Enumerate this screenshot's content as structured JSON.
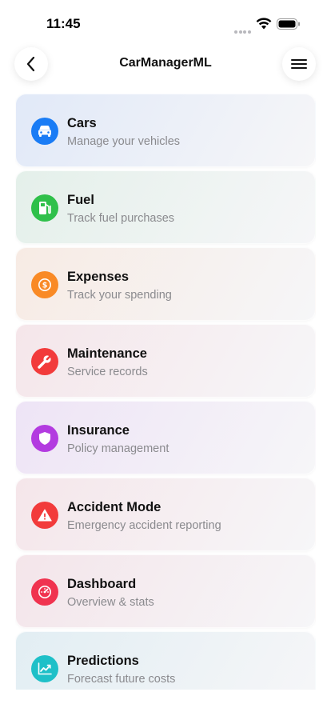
{
  "status_bar": {
    "time": "11:45"
  },
  "header": {
    "title": "CarManagerML"
  },
  "menu": [
    {
      "title": "Cars",
      "subtitle": "Manage your vehicles",
      "icon": "car-icon",
      "color": "#1a7cf5",
      "bg": "#e1e9f8"
    },
    {
      "title": "Fuel",
      "subtitle": "Track fuel purchases",
      "icon": "fuel-pump-icon",
      "color": "#2fc04a",
      "bg": "#e4f0ea"
    },
    {
      "title": "Expenses",
      "subtitle": "Track your spending",
      "icon": "dollar-icon",
      "color": "#f98a26",
      "bg": "#f7ebe4"
    },
    {
      "title": "Maintenance",
      "subtitle": "Service records",
      "icon": "wrench-icon",
      "color": "#f23b3b",
      "bg": "#f5e6ea"
    },
    {
      "title": "Insurance",
      "subtitle": "Policy management",
      "icon": "shield-icon",
      "color": "#b33be0",
      "bg": "#eee4f6"
    },
    {
      "title": "Accident Mode",
      "subtitle": "Emergency accident reporting",
      "icon": "warning-icon",
      "color": "#f23b3b",
      "bg": "#f5e6ea"
    },
    {
      "title": "Dashboard",
      "subtitle": "Overview & stats",
      "icon": "gauge-icon",
      "color": "#f0334f",
      "bg": "#f4e5ea"
    },
    {
      "title": "Predictions",
      "subtitle": "Forecast future costs",
      "icon": "trend-chart-icon",
      "color": "#1ec0c8",
      "bg": "#e2eef3"
    }
  ]
}
